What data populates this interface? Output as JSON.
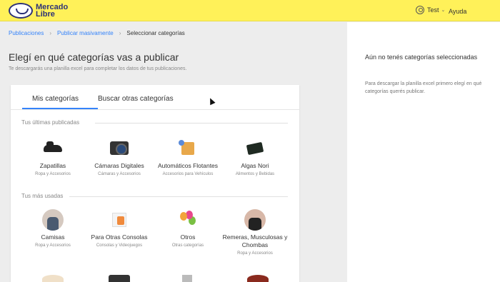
{
  "header": {
    "logo_text": "Mercado Libre",
    "user_name": "Test",
    "help_label": "Ayuda"
  },
  "breadcrumb": {
    "items": [
      "Publicaciones",
      "Publicar masivamente"
    ],
    "current": "Seleccionar categorías"
  },
  "page": {
    "title": "Elegí en qué categorías vas a publicar",
    "subtitle": "Te descargarás una planilla excel para completar los datos de tus publicaciones."
  },
  "tabs": [
    "Mis categorías",
    "Buscar otras categorías"
  ],
  "sections": {
    "recent_label": "Tus últimas publicadas",
    "most_used_label": "Tus más usadas"
  },
  "recent_items": [
    {
      "name": "Zapatillas",
      "sub": "Ropa y Accesorios",
      "icon": "shoe-icon"
    },
    {
      "name": "Cámaras Digitales",
      "sub": "Cámaras y Accesorios",
      "icon": "camera-icon"
    },
    {
      "name": "Automáticos Flotantes",
      "sub": "Accesorios para Vehículos",
      "icon": "float-switch-icon"
    },
    {
      "name": "Algas Nori",
      "sub": "Alimentos y Bebidas",
      "icon": "nori-icon"
    }
  ],
  "used_items": [
    {
      "name": "Camisas",
      "sub": "Ropa y Accesorios",
      "icon": "shirt-icon"
    },
    {
      "name": "Para Otras Consolas",
      "sub": "Consolas y Videojuegos",
      "icon": "console-icon"
    },
    {
      "name": "Otros",
      "sub": "Otras categorías",
      "icon": "balloons-icon"
    },
    {
      "name": "Remeras, Musculosas y Chombas",
      "sub": "Ropa y Accesorios",
      "icon": "tshirt-icon"
    }
  ],
  "right_panel": {
    "title": "Aún no tenés categorías seleccionadas",
    "text": "Para descargar la planilla excel primero elegí en qué categorías querés publicar."
  },
  "colors": {
    "header_bg": "#fff159",
    "accent": "#3483fa",
    "brand": "#2d3277"
  }
}
